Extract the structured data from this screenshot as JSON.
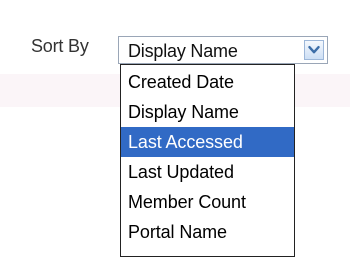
{
  "sort": {
    "label": "Sort By",
    "selected_value": "Display Name",
    "highlighted_option": "Last Accessed",
    "options": [
      "Created Date",
      "Display Name",
      "Last Accessed",
      "Last Updated",
      "Member Count",
      "Portal Name"
    ],
    "arrow_icon": "chevron-down-icon"
  },
  "colors": {
    "highlight": "#316ac5",
    "highlight_text": "#ffffff",
    "arrow": "#3d6ea8"
  }
}
